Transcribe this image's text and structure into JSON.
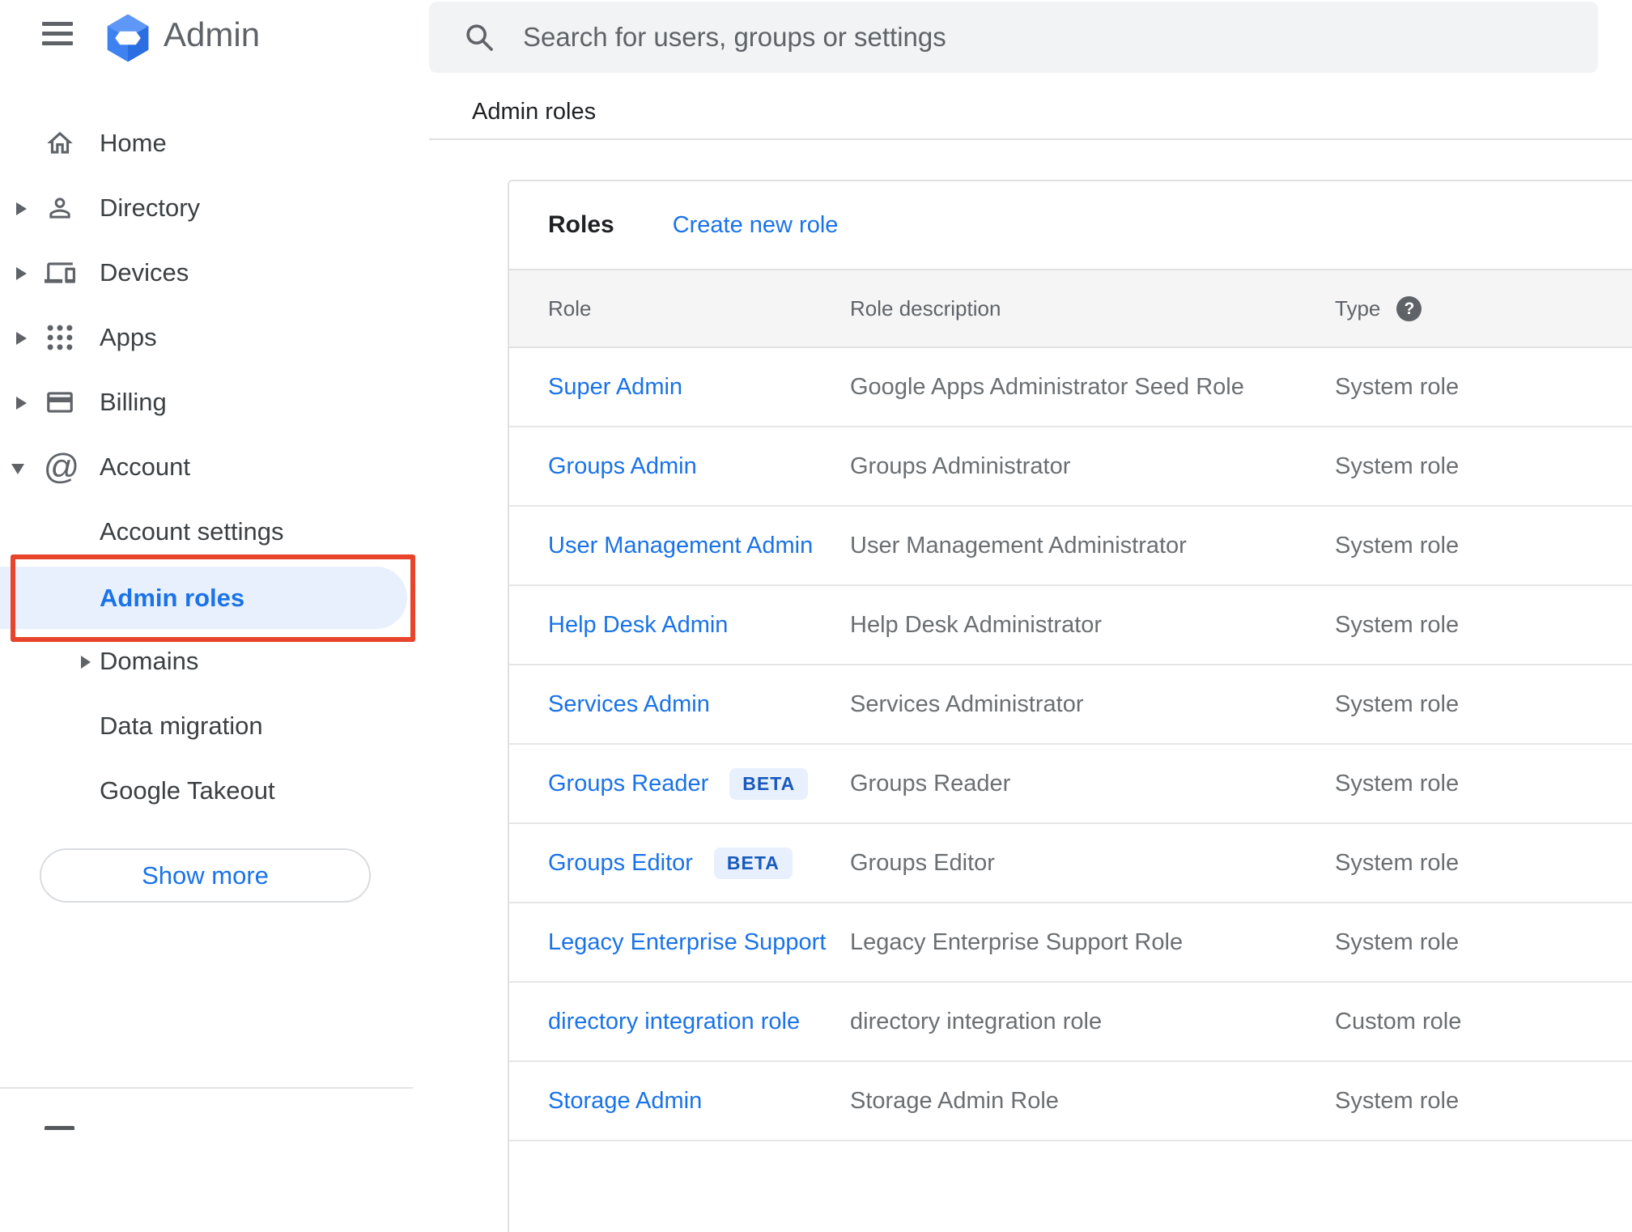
{
  "app": {
    "name": "Admin"
  },
  "topbar": {
    "search_placeholder": "Search for users, groups or settings"
  },
  "breadcrumb": "Admin roles",
  "sidebar": {
    "items": [
      {
        "label": "Home",
        "icon": "home-icon",
        "expandable": false
      },
      {
        "label": "Directory",
        "icon": "person-icon",
        "expandable": true
      },
      {
        "label": "Devices",
        "icon": "devices-icon",
        "expandable": true
      },
      {
        "label": "Apps",
        "icon": "apps-grid-icon",
        "expandable": true
      },
      {
        "label": "Billing",
        "icon": "credit-card-icon",
        "expandable": true
      },
      {
        "label": "Account",
        "icon": "at-sign-icon",
        "expandable": true,
        "expanded": true
      }
    ],
    "account_children": [
      {
        "label": "Account settings",
        "selected": false
      },
      {
        "label": "Admin roles",
        "selected": true
      },
      {
        "label": "Domains",
        "expandable": true,
        "selected": false
      },
      {
        "label": "Data migration",
        "selected": false
      },
      {
        "label": "Google Takeout",
        "selected": false
      }
    ],
    "show_more_label": "Show more"
  },
  "content": {
    "section_title": "Roles",
    "create_link": "Create new role",
    "table": {
      "columns": [
        "Role",
        "Role description",
        "Type"
      ],
      "beta_label": "BETA",
      "rows": [
        {
          "role": "Super Admin",
          "beta": false,
          "description": "Google Apps Administrator Seed Role",
          "type": "System role"
        },
        {
          "role": "Groups Admin",
          "beta": false,
          "description": "Groups Administrator",
          "type": "System role"
        },
        {
          "role": "User Management Admin",
          "beta": false,
          "description": "User Management Administrator",
          "type": "System role"
        },
        {
          "role": "Help Desk Admin",
          "beta": false,
          "description": "Help Desk Administrator",
          "type": "System role"
        },
        {
          "role": "Services Admin",
          "beta": false,
          "description": "Services Administrator",
          "type": "System role"
        },
        {
          "role": "Groups Reader",
          "beta": true,
          "description": "Groups Reader",
          "type": "System role"
        },
        {
          "role": "Groups Editor",
          "beta": true,
          "description": "Groups Editor",
          "type": "System role"
        },
        {
          "role": "Legacy Enterprise Support",
          "beta": false,
          "description": "Legacy Enterprise Support Role",
          "type": "System role"
        },
        {
          "role": "directory integration role",
          "beta": false,
          "description": "directory integration role",
          "type": "Custom role"
        },
        {
          "role": "Storage Admin",
          "beta": false,
          "description": "Storage Admin Role",
          "type": "System role"
        }
      ]
    }
  },
  "annotation": {
    "type": "highlight-box",
    "target": "Admin roles sidebar item",
    "color": "#e8432b"
  },
  "colors": {
    "link_blue": "#1a73e8",
    "selected_pill_bg": "#e8f0fe",
    "beta_badge_bg": "#e8f0fe",
    "beta_badge_text": "#185abc",
    "muted_text": "#5f6368",
    "divider": "#e0e0e0",
    "search_bg": "#f1f3f4",
    "table_header_bg": "#f5f5f6",
    "annotation_red": "#e8432b"
  },
  "icons": {
    "hamburger": "hamburger-menu-icon",
    "logo": "admin-hexagon-logo",
    "search": "search-icon",
    "help": "help-icon"
  }
}
